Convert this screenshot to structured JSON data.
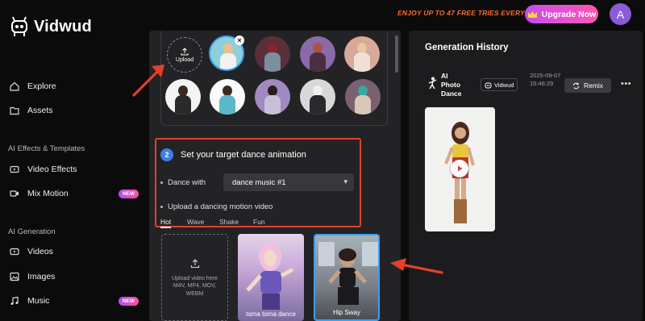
{
  "brand": {
    "name": "Vidwud"
  },
  "topbar": {
    "promo": "ENJOY UP TO 47 FREE TRIES EVERY DAY!",
    "upgrade_label": "Upgrade Now",
    "avatar_initial": "A"
  },
  "sidebar": {
    "explore": "Explore",
    "assets": "Assets",
    "section_effects": "AI Effects & Templates",
    "video_effects": "Video Effects",
    "mix_motion": "Mix Motion",
    "new_badge": "NEW",
    "section_generation": "AI Generation",
    "videos": "Videos",
    "images": "Images",
    "music": "Music"
  },
  "upload": {
    "label": "Upload"
  },
  "step2": {
    "number": "2",
    "title": "Set your target dance animation",
    "dance_with_label": "Dance with",
    "dance_select": "dance music #1",
    "upload_motion_label": "Upload a dancing motion video",
    "tabs": [
      "Hot",
      "Wave",
      "Shake",
      "Fun"
    ],
    "upload_hint": "Upload video here M4V, MP4, MOV, WEBM",
    "videos": [
      "toma toma dance",
      "Hip Sway"
    ]
  },
  "history": {
    "title": "Generation History",
    "type": "AI Photo Dance",
    "brand": "Vidwud",
    "time": "2025-09-07 15:46:29",
    "remix": "Remix"
  },
  "colors": {
    "accent": "#3f7ee8",
    "highlight": "#e2402c",
    "promo": "#ff6a2b",
    "upgrade_start": "#c64cf0",
    "upgrade_end": "#ff56b0"
  }
}
